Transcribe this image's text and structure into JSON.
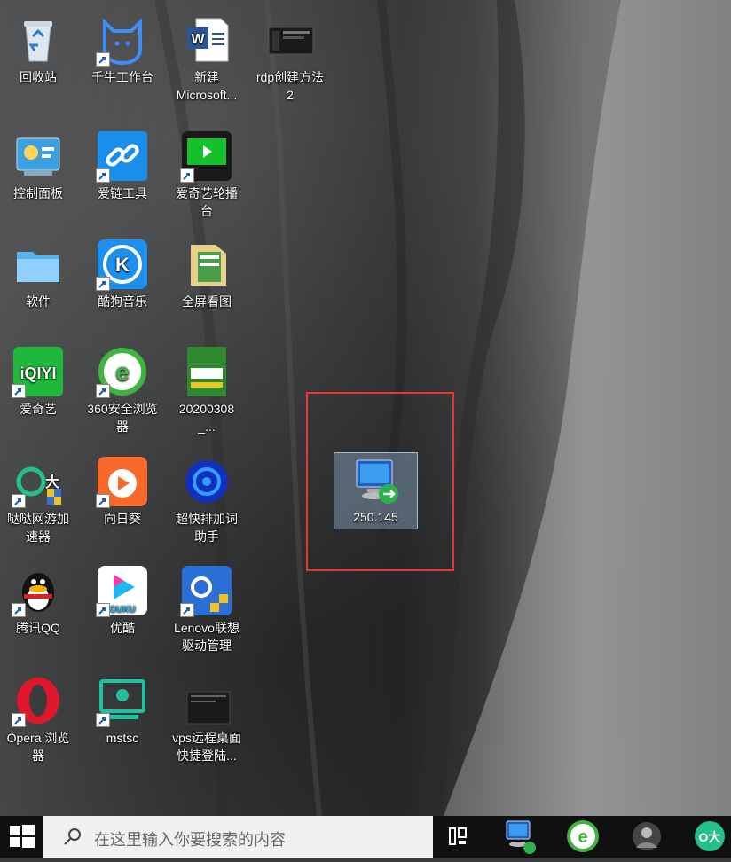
{
  "desktop": {
    "icons": [
      {
        "label": "回收站",
        "icon": "recycle-bin-icon"
      },
      {
        "label": "千牛工作台",
        "icon": "qianniu-icon"
      },
      {
        "label": "新建\nMicrosoft...",
        "icon": "word-doc-icon"
      },
      {
        "label": "rdp创建方法\n2",
        "icon": "screenshot-file-icon"
      },
      {
        "label": "控制面板",
        "icon": "control-panel-icon"
      },
      {
        "label": "爱链工具",
        "icon": "link-tool-icon"
      },
      {
        "label": "爱奇艺轮播\n台",
        "icon": "iqiyi-carousel-icon"
      },
      {
        "label": "软件",
        "icon": "folder-icon"
      },
      {
        "label": "酷狗音乐",
        "icon": "kugou-icon"
      },
      {
        "label": "全屏看图",
        "icon": "image-viewer-icon"
      },
      {
        "label": "爱奇艺",
        "icon": "iqiyi-icon"
      },
      {
        "label": "360安全浏览\n器",
        "icon": "browser-360-icon"
      },
      {
        "label": "20200308_...",
        "icon": "image-file-icon"
      },
      {
        "label": "哒哒网游加\n速器",
        "icon": "dada-accelerator-icon"
      },
      {
        "label": "向日葵",
        "icon": "sunflower-icon"
      },
      {
        "label": "超快排加词\n助手",
        "icon": "chaokuaipai-icon"
      },
      {
        "label": "腾讯QQ",
        "icon": "qq-penguin-icon"
      },
      {
        "label": "优酷",
        "icon": "youku-icon"
      },
      {
        "label": "Lenovo联想\n驱动管理",
        "icon": "lenovo-driver-icon"
      },
      {
        "label": "Opera 浏览\n器",
        "icon": "opera-icon"
      },
      {
        "label": "mstsc",
        "icon": "mstsc-icon"
      },
      {
        "label": "vps远程桌面\n快捷登陆...",
        "icon": "dark-file-icon"
      }
    ],
    "selected": {
      "label": "250.145",
      "icon": "remote-desktop-icon"
    }
  },
  "taskbar": {
    "search_placeholder": "在这里输入你要搜索的内容",
    "items": [
      "task-view-icon",
      "remote-desktop-icon",
      "browser-360-icon",
      "avatar-icon",
      "dada-icon"
    ]
  },
  "colors": {
    "highlight_border": "#e33333",
    "taskbar": "#101010"
  }
}
